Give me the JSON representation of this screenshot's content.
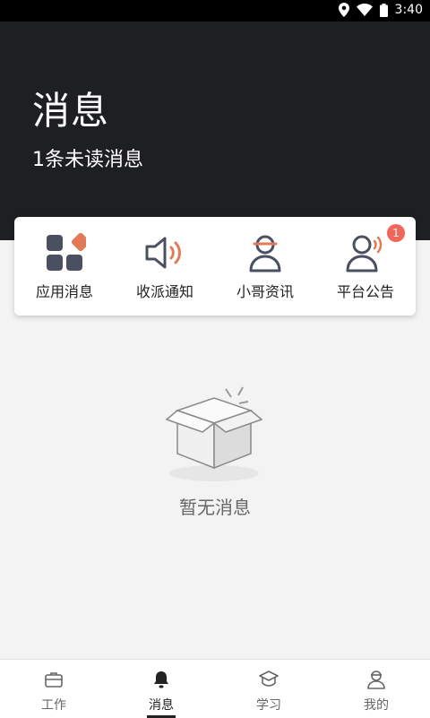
{
  "status_bar": {
    "time": "3:40"
  },
  "header": {
    "title": "消息",
    "subtitle": "1条未读消息"
  },
  "categories": [
    {
      "label": "应用消息",
      "icon": "apps-grid-icon"
    },
    {
      "label": "收派通知",
      "icon": "speaker-icon"
    },
    {
      "label": "小哥资讯",
      "icon": "courier-person-icon"
    },
    {
      "label": "平台公告",
      "icon": "announcement-person-icon",
      "badge": "1"
    }
  ],
  "empty_state": {
    "text": "暂无消息",
    "icon": "empty-box-icon"
  },
  "tabs": [
    {
      "label": "工作",
      "icon": "briefcase-icon"
    },
    {
      "label": "消息",
      "icon": "bell-icon",
      "active": true
    },
    {
      "label": "学习",
      "icon": "graduation-cap-icon"
    },
    {
      "label": "我的",
      "icon": "profile-icon"
    }
  ],
  "colors": {
    "accent": "#e07a57",
    "header_bg": "#1e1f23",
    "badge": "#f0675a",
    "icon_dark": "#4a5060"
  }
}
